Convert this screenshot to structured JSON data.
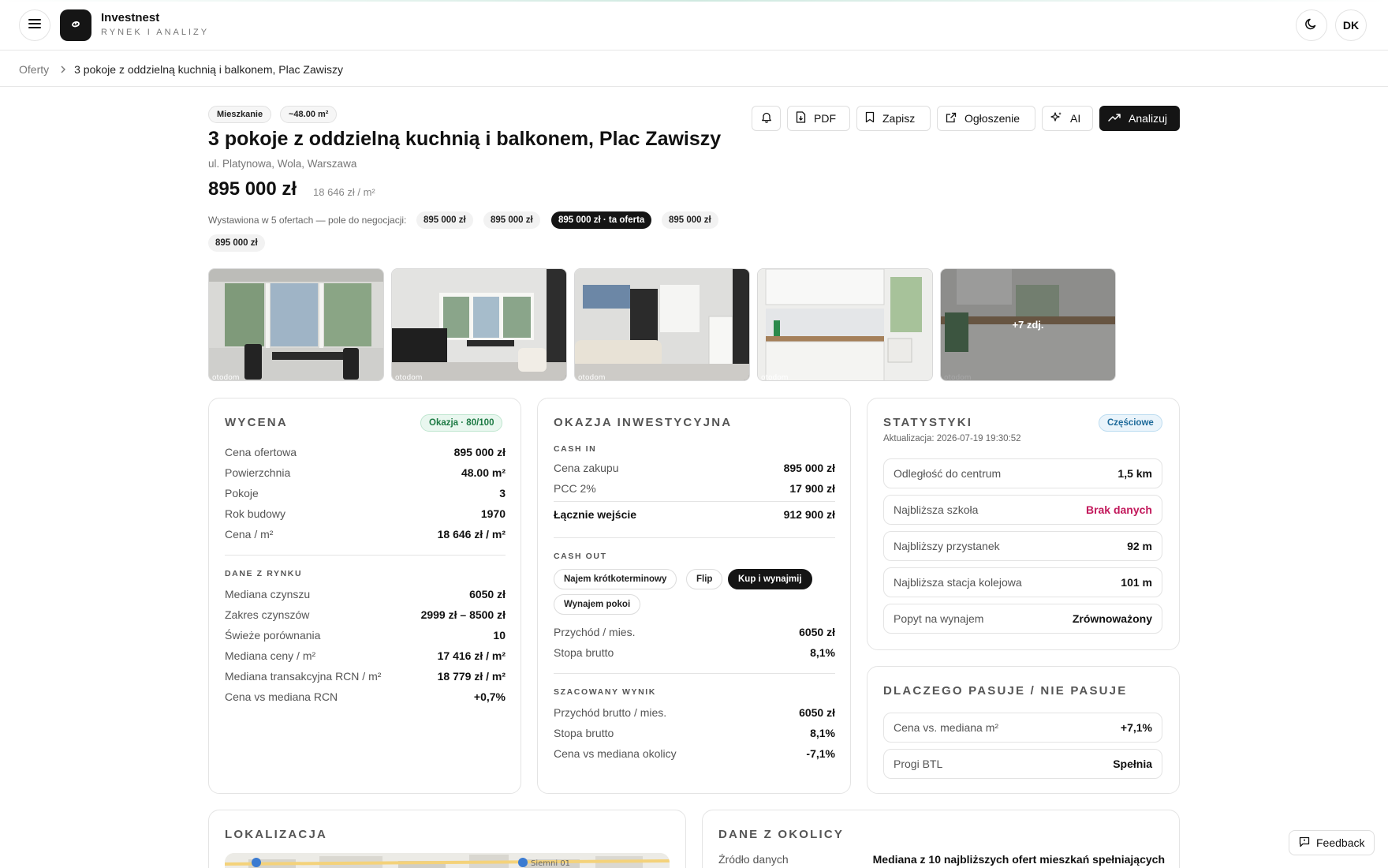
{
  "app": {
    "brand": "Investnest",
    "subtitle": "RYNEK I ANALIZY",
    "avatar_initials": "DK"
  },
  "icons": {
    "menu": "hamburger-icon",
    "logo": "swirl-logo-icon",
    "theme": "moon-icon",
    "breadcrumb_sep": "chevron-right-icon"
  },
  "breadcrumb": {
    "root": "Oferty",
    "current": "3 pokoje z oddzielną kuchnią i balkonem, Plac Zawiszy"
  },
  "listing": {
    "chips": [
      "Mieszkanie",
      "~48.00 m²"
    ],
    "title": "3 pokoje z oddzielną kuchnią i balkonem, Plac Zawiszy",
    "address": "ul. Platynowa, Wola, Warszawa",
    "price": "895 000 zł",
    "price_per_m2": "18 646 zł / m²",
    "offers_label": "Wystawiona w 5 ofertach — pole do negocjacji:",
    "offers": [
      "895 000 zł",
      "895 000 zł",
      "895 000 zł · ta oferta",
      "895 000 zł",
      "895 000 zł"
    ]
  },
  "actions": {
    "pdf": "PDF",
    "save": "Zapisz",
    "listing": "Ogłoszenie",
    "ai": "AI",
    "analyze": "Analizuj"
  },
  "gallery": {
    "watermark": "otodom",
    "more_label": "+7 zdj."
  },
  "valuation": {
    "title": "WYCENA",
    "badge": "Okazja · 80/100",
    "rows": [
      {
        "label": "Cena ofertowa",
        "value": "895 000 zł"
      },
      {
        "label": "Powierzchnia",
        "value": "48.00 m²"
      },
      {
        "label": "Pokoje",
        "value": "3"
      },
      {
        "label": "Rok budowy",
        "value": "1970"
      },
      {
        "label": "Cena / m²",
        "value": "18 646 zł / m²"
      }
    ],
    "market_label": "DANE Z RYNKU",
    "market_rows": [
      {
        "label": "Mediana czynszu",
        "value": "6050 zł"
      },
      {
        "label": "Zakres czynszów",
        "value": "2999 zł – 8500 zł"
      },
      {
        "label": "Świeże porównania",
        "value": "10"
      },
      {
        "label": "Mediana ceny / m²",
        "value": "17 416 zł / m²"
      },
      {
        "label": "Mediana transakcyjna RCN / m²",
        "value": "18 779 zł / m²"
      },
      {
        "label": "Cena vs mediana RCN",
        "value": "+0,7%"
      }
    ]
  },
  "investment": {
    "title": "OKAZJA INWESTYCYJNA",
    "cash_in_label": "CASH IN",
    "cash_in": [
      {
        "label": "Cena zakupu",
        "value": "895 000 zł"
      },
      {
        "label": "PCC 2%",
        "value": "17 900 zł"
      }
    ],
    "total": {
      "label": "Łącznie wejście",
      "value": "912 900 zł"
    },
    "cash_out_label": "CASH OUT",
    "strategies": [
      "Najem krótkoterminowy",
      "Flip",
      "Kup i wynajmij",
      "Wynajem pokoi"
    ],
    "cash_out": [
      {
        "label": "Przychód / mies.",
        "value": "6050 zł"
      },
      {
        "label": "Stopa brutto",
        "value": "8,1%"
      }
    ],
    "estimate_label": "SZACOWANY WYNIK",
    "estimate": [
      {
        "label": "Przychód brutto / mies.",
        "value": "6050 zł"
      },
      {
        "label": "Stopa brutto",
        "value": "8,1%"
      },
      {
        "label": "Cena vs mediana okolicy",
        "value": "-7,1%"
      }
    ]
  },
  "stats": {
    "title": "STATYSTYKI",
    "badge": "Częściowe",
    "updated": "Aktualizacja: 2026-07-19 19:30:52",
    "rows": [
      {
        "label": "Odległość do centrum",
        "value": "1,5 km"
      },
      {
        "label": "Najbliższa szkoła",
        "value": "Brak danych"
      },
      {
        "label": "Najbliższy przystanek",
        "value": "92 m"
      },
      {
        "label": "Najbliższa stacja kolejowa",
        "value": "101 m"
      },
      {
        "label": "Popyt na wynajem",
        "value": "Zrównoważony"
      }
    ]
  },
  "fit": {
    "title": "DLACZEGO PASUJE / NIE PASUJE",
    "rows": [
      {
        "label": "Cena vs. mediana m²",
        "value": "+7,1%"
      },
      {
        "label": "Progi BTL",
        "value": "Spełnia"
      }
    ]
  },
  "location": {
    "title": "LOKALIZACJA",
    "map_labels": [
      "Siemni 01"
    ]
  },
  "neighborhood": {
    "title": "DANE Z OKOLICY",
    "rows": [
      {
        "label": "Źródło danych",
        "value": "Mediana z 10 najbliższych ofert mieszkań spełniających"
      }
    ]
  },
  "feedback": {
    "label": "Feedback"
  },
  "colors": {
    "accent_dark": "#151515",
    "success": "#1d7a44",
    "info": "#1d6a9a",
    "danger": "#c2185b"
  }
}
